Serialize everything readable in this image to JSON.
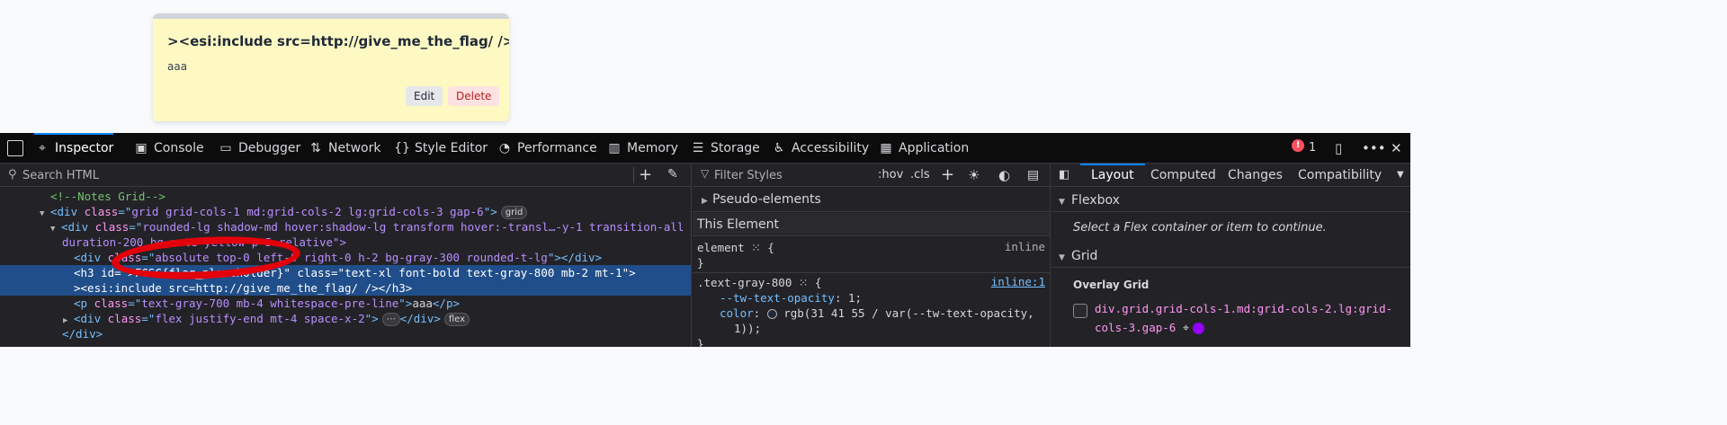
{
  "note": {
    "title": "><esi:include src=http://give_me_the_flag/ />",
    "body": "aaa",
    "edit_label": "Edit",
    "delete_label": "Delete"
  },
  "devtools": {
    "tabs": [
      {
        "label": "Inspector",
        "icon": "inspector-icon"
      },
      {
        "label": "Console",
        "icon": "console-icon"
      },
      {
        "label": "Debugger",
        "icon": "debugger-icon"
      },
      {
        "label": "Network",
        "icon": "network-icon"
      },
      {
        "label": "Style Editor",
        "icon": "style-editor-icon"
      },
      {
        "label": "Performance",
        "icon": "performance-icon"
      },
      {
        "label": "Memory",
        "icon": "memory-icon"
      },
      {
        "label": "Storage",
        "icon": "storage-icon"
      },
      {
        "label": "Accessibility",
        "icon": "accessibility-icon"
      },
      {
        "label": "Application",
        "icon": "application-icon"
      }
    ],
    "error_count": "1",
    "search_placeholder": "Search HTML",
    "tree": {
      "comment": "<!--Notes Grid-->",
      "grid_div_class": "grid grid-cols-1 md:grid-cols-2 lg:grid-cols-3 gap-6",
      "grid_badge": "grid",
      "note_div_class_1": "rounded-lg shadow-md hover:shadow-lg transform hover:-transl…-y-1 transition-all",
      "note_div_class_2": "duration-200 bg-note-yellow p-5 relative\">",
      "bar_div_class": "absolute top-0 left-0 right-0 h-2 bg-gray-300 rounded-t-lg",
      "h3_id": ">FCSC{flag_placeholder}",
      "h3_class": "text-xl font-bold text-gray-800 mb-2 mt-1",
      "h3_text": "><esi:include src=http://give_me_the_flag/ /></h3>",
      "p_class": "text-gray-700 mb-4 whitespace-pre-line",
      "p_text": "aaa",
      "flex_div_class": "flex justify-end mt-4 space-x-2",
      "flex_badge": "flex",
      "close_div": "</div>"
    },
    "rules": {
      "filter_placeholder": "Filter Styles",
      "hov": ":hov",
      "cls": ".cls",
      "pseudo_elements": "Pseudo-elements",
      "this_element": "This Element",
      "element_selector": "element",
      "element_source": "inline",
      "rule_selector": ".text-gray-800",
      "rule_source": "inline:1",
      "prop1_name": "--tw-text-opacity",
      "prop1_value": "1;",
      "prop2_name": "color",
      "prop2_value": "rgb(31 41 55 / var(--tw-text-opacity,",
      "prop2_value_cont": "1));"
    },
    "side": {
      "tabs": [
        "Layout",
        "Computed",
        "Changes",
        "Compatibility"
      ],
      "flexbox": "Flexbox",
      "flex_hint": "Select a Flex container or item to continue.",
      "grid": "Grid",
      "overlay_grid": "Overlay Grid",
      "grid_selector": "div.grid.grid-cols-1.md:grid-cols-2.lg:grid-cols-3.gap-6"
    }
  }
}
